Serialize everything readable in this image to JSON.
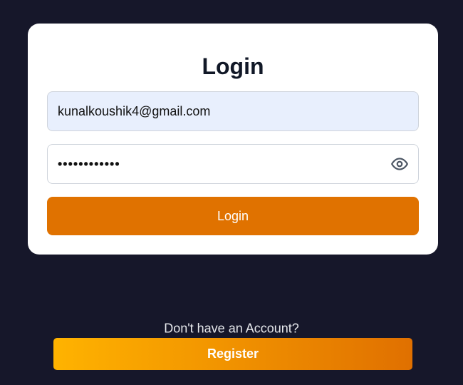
{
  "login": {
    "title": "Login",
    "email_value": "kunalkoushik4@gmail.com",
    "password_masked": "••••••••••••",
    "password_toggle_icon": "eye-icon",
    "submit_label": "Login"
  },
  "footer": {
    "prompt": "Don't have an Account?",
    "register_label": "Register"
  },
  "colors": {
    "background": "#16172a",
    "card": "#ffffff",
    "accent": "#e07200",
    "register_gradient_start": "#ffb300",
    "register_gradient_end": "#e07000"
  }
}
